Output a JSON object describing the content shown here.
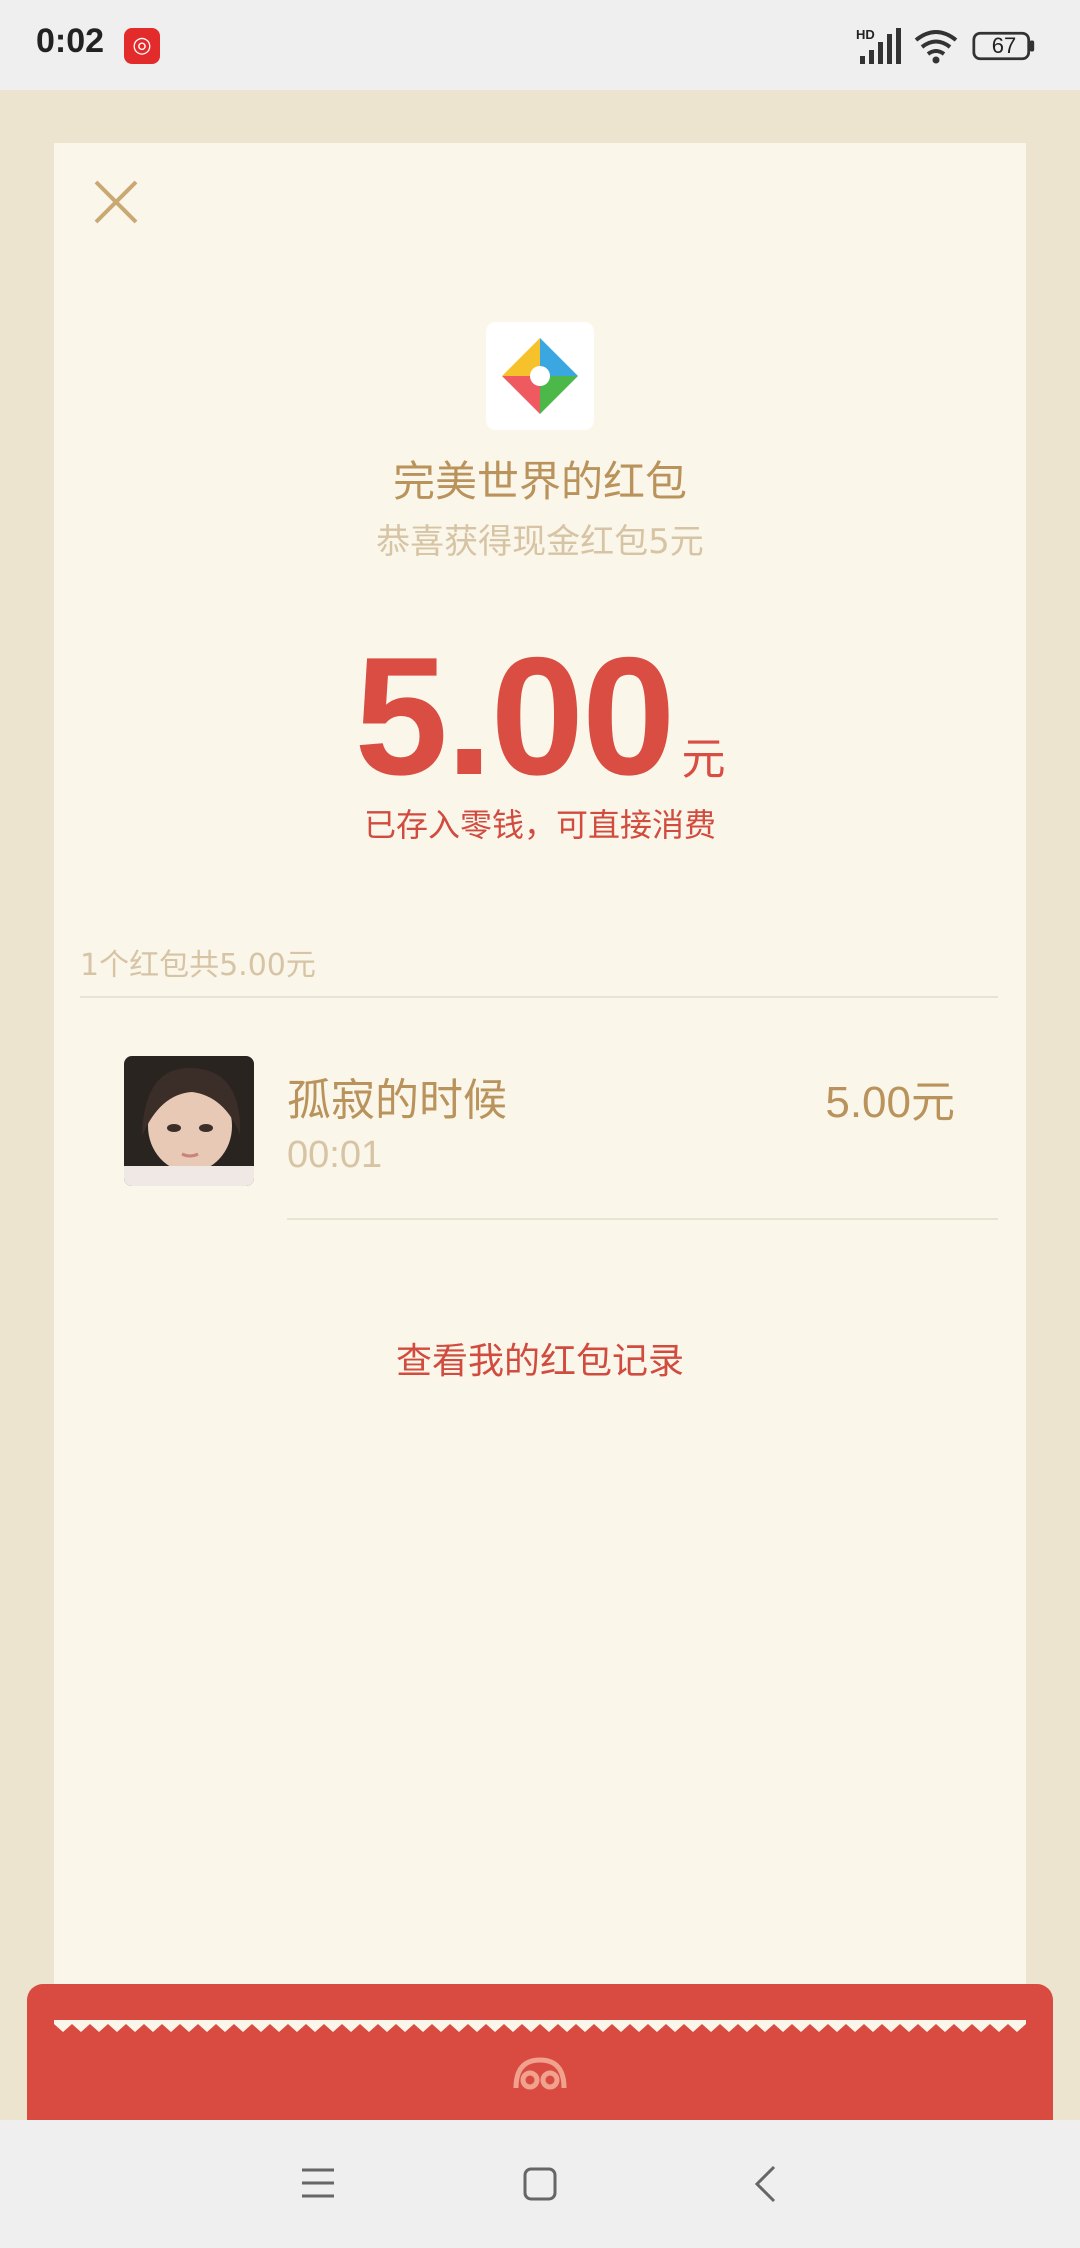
{
  "status_bar": {
    "time": "0:02",
    "battery": "67",
    "network_label": "HD"
  },
  "packet": {
    "sender_title": "完美世界的红包",
    "greeting": "恭喜获得现金红包5元",
    "amount": "5.00",
    "amount_unit": "元",
    "deposit_note": "已存入零钱，可直接消费"
  },
  "summary": {
    "text": "1个红包共5.00元"
  },
  "recipients": [
    {
      "name": "孤寂的时候",
      "time": "00:01",
      "amount": "5.00元"
    }
  ],
  "records_link": "查看我的红包记录",
  "colors": {
    "accent_red": "#d94d42",
    "gold_text": "#b9935b",
    "light_gold_text": "#d6c4a4",
    "card_bg": "#fbf6ea",
    "page_bg": "#ede4d0"
  },
  "icons": {
    "close": "close-icon",
    "app_logo": "pinwheel-logo-icon",
    "footer": "wechat-pay-logo-icon",
    "nav": [
      "menu-icon",
      "home-icon",
      "back-icon"
    ]
  }
}
